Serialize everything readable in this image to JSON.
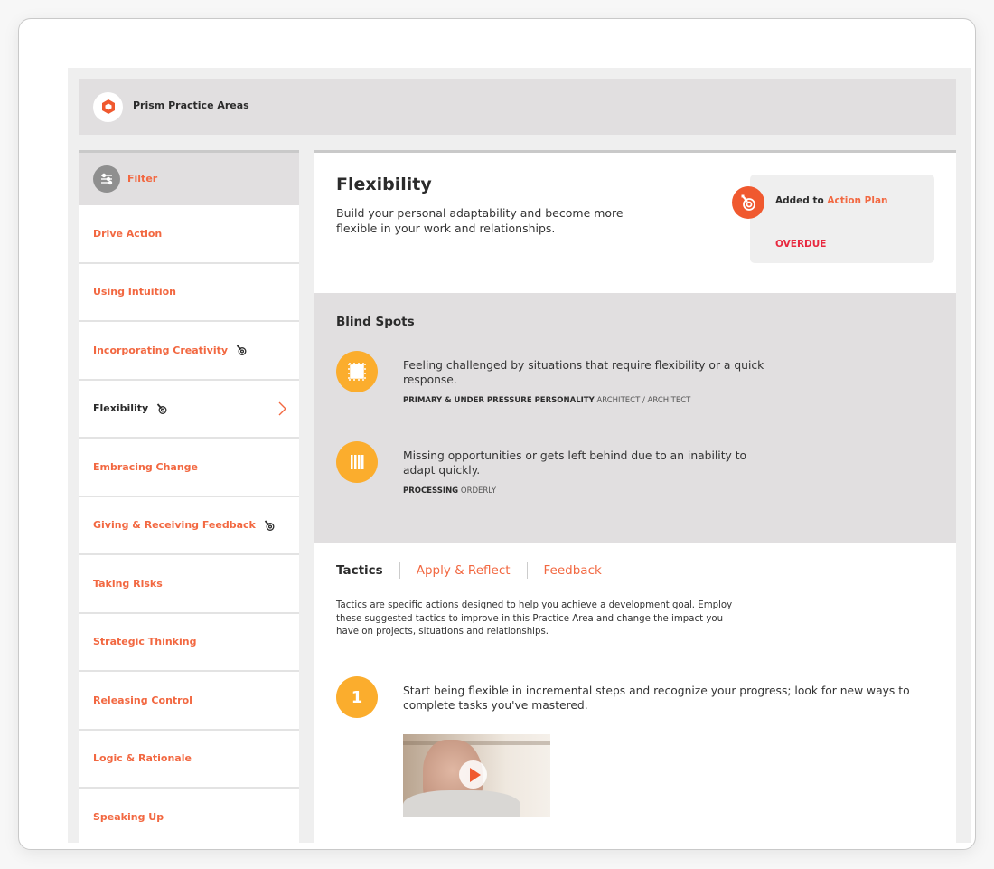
{
  "header": {
    "title": "Prism Practice Areas",
    "logo_icon": "hexagon-logo-icon"
  },
  "sidebar": {
    "filter_label": "Filter",
    "items": [
      {
        "label": "Drive Action",
        "in_plan": false,
        "active": false
      },
      {
        "label": "Using Intuition",
        "in_plan": false,
        "active": false
      },
      {
        "label": "Incorporating Creativity",
        "in_plan": true,
        "active": false
      },
      {
        "label": "Flexibility",
        "in_plan": true,
        "active": true
      },
      {
        "label": "Embracing Change",
        "in_plan": false,
        "active": false
      },
      {
        "label": "Giving & Receiving Feedback",
        "in_plan": true,
        "active": false
      },
      {
        "label": "Taking Risks",
        "in_plan": false,
        "active": false
      },
      {
        "label": "Strategic Thinking",
        "in_plan": false,
        "active": false
      },
      {
        "label": "Releasing Control",
        "in_plan": false,
        "active": false
      },
      {
        "label": "Logic & Rationale",
        "in_plan": false,
        "active": false
      },
      {
        "label": "Speaking Up",
        "in_plan": false,
        "active": false
      }
    ]
  },
  "main": {
    "title": "Flexibility",
    "description": "Build your personal adaptability and become more flexible in your work and relationships.",
    "action_plan": {
      "prefix": "Added to ",
      "link": "Action Plan",
      "status": "OVERDUE"
    },
    "blind_spots": {
      "title": "Blind Spots",
      "items": [
        {
          "text": "Feeling challenged by situations that require flexibility or a quick response.",
          "meta_label": "PRIMARY & UNDER PRESSURE PERSONALITY",
          "meta_value": "ARCHITECT / ARCHITECT",
          "icon": "square-frame-icon"
        },
        {
          "text": "Missing opportunities or gets left behind due to an inability to adapt quickly.",
          "meta_label": "PROCESSING",
          "meta_value": "ORDERLY",
          "icon": "columns-grid-icon"
        }
      ]
    },
    "tabs": [
      {
        "label": "Tactics",
        "active": true
      },
      {
        "label": "Apply & Reflect",
        "active": false
      },
      {
        "label": "Feedback",
        "active": false
      }
    ],
    "tactics_description": "Tactics are specific actions designed to help you achieve a development goal. Employ these suggested tactics to improve in this Practice Area and change the impact you have on projects, situations and relationships.",
    "tactics": [
      {
        "number": "1",
        "text": "Start being flexible in incremental steps and recognize your progress; look for new ways to complete tasks you've mastered."
      }
    ]
  },
  "colors": {
    "accent": "#f26841",
    "badge": "#f0592f",
    "overdue": "#e8293f",
    "icon_bg": "#fbad2d"
  }
}
